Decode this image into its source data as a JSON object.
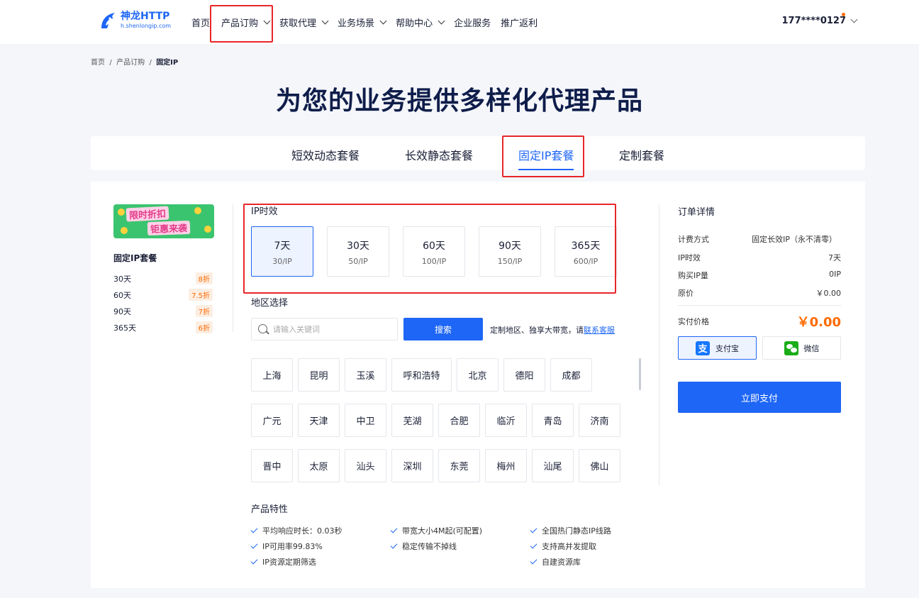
{
  "header": {
    "logo_name": "神龙HTTP",
    "logo_url": "h.shenlongip.com",
    "nav": [
      {
        "label": "首页"
      },
      {
        "label": "产品订购"
      },
      {
        "label": "获取代理"
      },
      {
        "label": "业务场景"
      },
      {
        "label": "帮助中心"
      },
      {
        "label": "企业服务"
      },
      {
        "label": "推广返利"
      }
    ],
    "user": "177****0127"
  },
  "breadcrumb": [
    "首页",
    "产品订购",
    "固定IP"
  ],
  "hero_title": "为您的业务提供多样化代理产品",
  "tabs": [
    "短效动态套餐",
    "长效静态套餐",
    "固定IP套餐",
    "定制套餐"
  ],
  "promo": {
    "line1": "限时折扣",
    "line2": "钜惠来袭"
  },
  "side": {
    "title": "固定IP套餐",
    "rows": [
      {
        "days": "30天",
        "discount": "8折"
      },
      {
        "days": "60天",
        "discount": "7.5折"
      },
      {
        "days": "90天",
        "discount": "7折"
      },
      {
        "days": "365天",
        "discount": "6折"
      }
    ]
  },
  "duration": {
    "label": "IP时效",
    "options": [
      {
        "days": "7天",
        "price": "30/IP"
      },
      {
        "days": "30天",
        "price": "50/IP"
      },
      {
        "days": "60天",
        "price": "100/IP"
      },
      {
        "days": "90天",
        "price": "150/IP"
      },
      {
        "days": "365天",
        "price": "600/IP"
      }
    ]
  },
  "region": {
    "label": "地区选择",
    "placeholder": "请输入关键词",
    "search_btn": "搜索",
    "note": "定制地区、独享大带宽，请",
    "note_link": "联系客服",
    "cities": [
      "上海",
      "昆明",
      "玉溪",
      "呼和浩特",
      "北京",
      "德阳",
      "成都",
      "广元",
      "天津",
      "中卫",
      "芜湖",
      "合肥",
      "临沂",
      "青岛",
      "济南",
      "晋中",
      "太原",
      "汕头",
      "深圳",
      "东莞",
      "梅州",
      "汕尾",
      "佛山"
    ]
  },
  "features": {
    "title": "产品特性",
    "items": [
      "平均响应时长：0.03秒",
      "带宽大小4M起(可配置)",
      "全国热门静态IP线路",
      "IP可用率99.83%",
      "稳定传输不掉线",
      "支持高并发提取",
      "IP资源定期筛选",
      "自建资源库"
    ]
  },
  "order": {
    "title": "订单详情",
    "rows": [
      {
        "k": "计费方式",
        "v": "固定长效IP（永不清零）"
      },
      {
        "k": "IP时效",
        "v": "7天"
      },
      {
        "k": "购买IP量",
        "v": "0IP"
      },
      {
        "k": "原价",
        "v": "￥0.00"
      }
    ],
    "paid_label": "实付价格",
    "paid_value": "￥0.00",
    "alipay": "支付宝",
    "wechat": "微信",
    "pay_btn": "立即支付"
  }
}
